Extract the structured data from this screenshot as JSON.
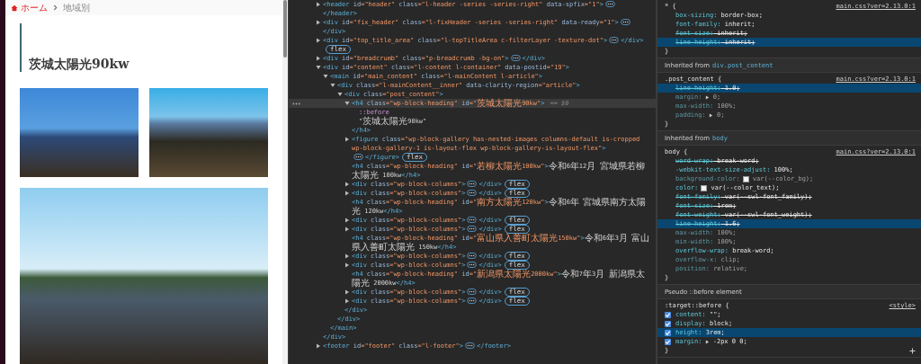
{
  "page": {
    "breadcrumb": [
      {
        "label": "ホーム",
        "kind": "home"
      },
      {
        "label": "地域別",
        "kind": "current"
      }
    ],
    "heading": "茨城太陽光90kw"
  },
  "dom_tree": [
    {
      "kind": "element",
      "code": "<header id=\"header\" class=\"l-header -series -series-right\" data-spfix=\"1\">",
      "close": "</header>",
      "expanded": false,
      "selected": false
    },
    {
      "kind": "element",
      "code": "<div id=\"fix_header\" class=\"l-fixHeader -series -series-right\" data-ready=\"1\">",
      "close": "</div>",
      "expanded": false,
      "selected": false
    },
    {
      "kind": "element",
      "code": "<div id=\"top_title_area\" class=\"l-topTitleArea c-filterLayer -texture-dot\">",
      "close": "</div>",
      "expanded": false,
      "selected": false,
      "badge": "flex"
    },
    {
      "kind": "element",
      "code": "<div id=\"breadcrumb\" class=\"p-breadcrumb -bg-on\">",
      "close": "</div>",
      "expanded": false,
      "selected": false
    },
    {
      "kind": "element",
      "code": "<div id=\"content\" class=\"l-content l-container\" data-postid=\"19\">",
      "close": "</div>",
      "expanded": true,
      "selected": false,
      "children": [
        {
          "kind": "element",
          "code": "<main id=\"main_content\" class=\"l-mainContent l-article\">",
          "close": "</main>",
          "expanded": true,
          "selected": false,
          "children": [
            {
              "kind": "element",
              "code": "<div class=\"l-mainContent__inner\" data-clarity-region=\"article\">",
              "close": "</div>",
              "expanded": true,
              "selected": false,
              "children": [
                {
                  "kind": "element",
                  "code": "<div class=\"post_content\">",
                  "close": "</div>",
                  "expanded": true,
                  "selected": false,
                  "children": [
                    {
                      "kind": "element",
                      "code": "<h4 class=\"wp-block-heading\" id=\"茨城太陽光90kw\">",
                      "close": "</h4>",
                      "expanded": true,
                      "selected": true,
                      "ref": "== $0",
                      "children": [
                        {
                          "kind": "pseudo",
                          "code": "::before",
                          "selected": false
                        },
                        {
                          "kind": "text",
                          "code": "\"茨城太陽光90kw\"",
                          "selected": false
                        }
                      ]
                    },
                    {
                      "kind": "element",
                      "code": "<figure class=\"wp-block-gallery has-nested-images columns-default is-cropped wp-block-gallery-1 is-layout-flex wp-block-gallery-is-layout-flex\">",
                      "close": "</figure>",
                      "expanded": false,
                      "selected": false,
                      "badge": "flex"
                    },
                    {
                      "kind": "leaf",
                      "code": "<h4 class=\"wp-block-heading\" id=\"若柳太陽光100kw\">令和6年12月 宮城県若柳太陽光 100kw</h4>",
                      "selected": false
                    },
                    {
                      "kind": "element",
                      "code": "<div class=\"wp-block-columns\">",
                      "close": "</div>",
                      "expanded": false,
                      "selected": false,
                      "badge": "flex"
                    },
                    {
                      "kind": "element",
                      "code": "<div class=\"wp-block-columns\">",
                      "close": "</div>",
                      "expanded": false,
                      "selected": false,
                      "badge": "flex"
                    },
                    {
                      "kind": "leaf",
                      "code": "<h4 class=\"wp-block-heading\" id=\"南方太陽光120kw\">令和6年 宮城県南方太陽光 120kw</h4>",
                      "selected": false
                    },
                    {
                      "kind": "element",
                      "code": "<div class=\"wp-block-columns\">",
                      "close": "</div>",
                      "expanded": false,
                      "selected": false,
                      "badge": "flex"
                    },
                    {
                      "kind": "element",
                      "code": "<div class=\"wp-block-columns\">",
                      "close": "</div>",
                      "expanded": false,
                      "selected": false,
                      "badge": "flex"
                    },
                    {
                      "kind": "leaf",
                      "code": "<h4 class=\"wp-block-heading\" id=\"富山県入善町太陽光150kw\">令和6年3月 富山県入善町太陽光 150kw</h4>",
                      "selected": false
                    },
                    {
                      "kind": "element",
                      "code": "<div class=\"wp-block-columns\">",
                      "close": "</div>",
                      "expanded": false,
                      "selected": false,
                      "badge": "flex"
                    },
                    {
                      "kind": "element",
                      "code": "<div class=\"wp-block-columns\">",
                      "close": "</div>",
                      "expanded": false,
                      "selected": false,
                      "badge": "flex"
                    },
                    {
                      "kind": "leaf",
                      "code": "<h4 class=\"wp-block-heading\" id=\"新潟県太陽光2000kw\">令和7年3月 新潟県太陽光 2000kw</h4>",
                      "selected": false
                    },
                    {
                      "kind": "element",
                      "code": "<div class=\"wp-block-columns\">",
                      "close": "</div>",
                      "expanded": false,
                      "selected": false,
                      "badge": "flex"
                    },
                    {
                      "kind": "element",
                      "code": "<div class=\"wp-block-columns\">",
                      "close": "</div>",
                      "expanded": false,
                      "selected": false,
                      "badge": "flex"
                    }
                  ]
                }
              ]
            }
          ]
        }
      ]
    },
    {
      "kind": "element",
      "code": "<footer id=\"footer\" class=\"l-footer\">",
      "close": "</footer>",
      "expanded": false,
      "selected": false
    }
  ],
  "styles": [
    {
      "kind": "rule",
      "open": "* {",
      "source": "main.css?ver=2.13.0:1",
      "close": "}",
      "props": [
        {
          "text": "box-sizing: border-box;",
          "kind": "active",
          "selected": false
        },
        {
          "text": "font-family: inherit;",
          "kind": "active",
          "selected": false
        },
        {
          "text": "font-size: inherit;",
          "kind": "overridden",
          "selected": false
        },
        {
          "text": "line-height: inherit;",
          "kind": "overridden",
          "selected": true
        }
      ]
    },
    {
      "kind": "inherited",
      "label": "Inherited from",
      "target": "div.post_content"
    },
    {
      "kind": "rule",
      "open": ".post_content {",
      "source": "main.css?ver=2.13.0:1",
      "close": "}",
      "props": [
        {
          "text": "line-height: 1.0;",
          "kind": "overridden",
          "selected": true
        },
        {
          "text": "margin: 0;",
          "kind": "inactive",
          "selected": false,
          "expandable": true
        },
        {
          "text": "max-width: 100%;",
          "kind": "inactive",
          "selected": false
        },
        {
          "text": "padding: 0;",
          "kind": "inactive",
          "selected": false,
          "expandable": true
        }
      ]
    },
    {
      "kind": "inherited",
      "label": "Inherited from",
      "target": "body"
    },
    {
      "kind": "rule",
      "open": "body {",
      "source": "main.css?ver=2.13.0:1",
      "close": "}",
      "props": [
        {
          "text": "word-wrap: break-word;",
          "kind": "overridden",
          "selected": false
        },
        {
          "text": "-webkit-text-size-adjust: 100%;",
          "kind": "active",
          "selected": false
        },
        {
          "text": "background-color: var(--color_bg);",
          "kind": "inactive",
          "selected": false,
          "swatch": true
        },
        {
          "text": "color: var(--color_text);",
          "kind": "active",
          "selected": false,
          "swatch": true
        },
        {
          "text": "font-family: var(--swl-font_family);",
          "kind": "overridden",
          "selected": false
        },
        {
          "text": "font-size: 1rem;",
          "kind": "overridden",
          "selected": false
        },
        {
          "text": "font-weight: var(--swl-font_weight);",
          "kind": "overridden",
          "selected": false
        },
        {
          "text": "line-height: 1.6;",
          "kind": "overridden",
          "selected": true
        },
        {
          "text": "max-width: 100%;",
          "kind": "inactive",
          "selected": false
        },
        {
          "text": "min-width: 100%;",
          "kind": "inactive",
          "selected": false
        },
        {
          "text": "overflow-wrap: break-word;",
          "kind": "active",
          "selected": false
        },
        {
          "text": "overflow-x: clip;",
          "kind": "inactive",
          "selected": false
        },
        {
          "text": "position: relative;",
          "kind": "inactive",
          "selected": false
        }
      ]
    },
    {
      "kind": "header",
      "label": "Pseudo ::before element"
    },
    {
      "kind": "rule",
      "open": ":target::before {",
      "source": "<style>",
      "close": "}",
      "props": [
        {
          "text": "content: \"\";",
          "kind": "active",
          "selected": false,
          "checked": true
        },
        {
          "text": "display: block;",
          "kind": "active",
          "selected": false,
          "checked": true
        },
        {
          "text": "height: 3rem;",
          "kind": "active",
          "selected": true,
          "checked": true
        },
        {
          "text": "margin: -2px 0 0;",
          "kind": "active",
          "selected": false,
          "checked": true,
          "expandable": true
        }
      ]
    }
  ]
}
